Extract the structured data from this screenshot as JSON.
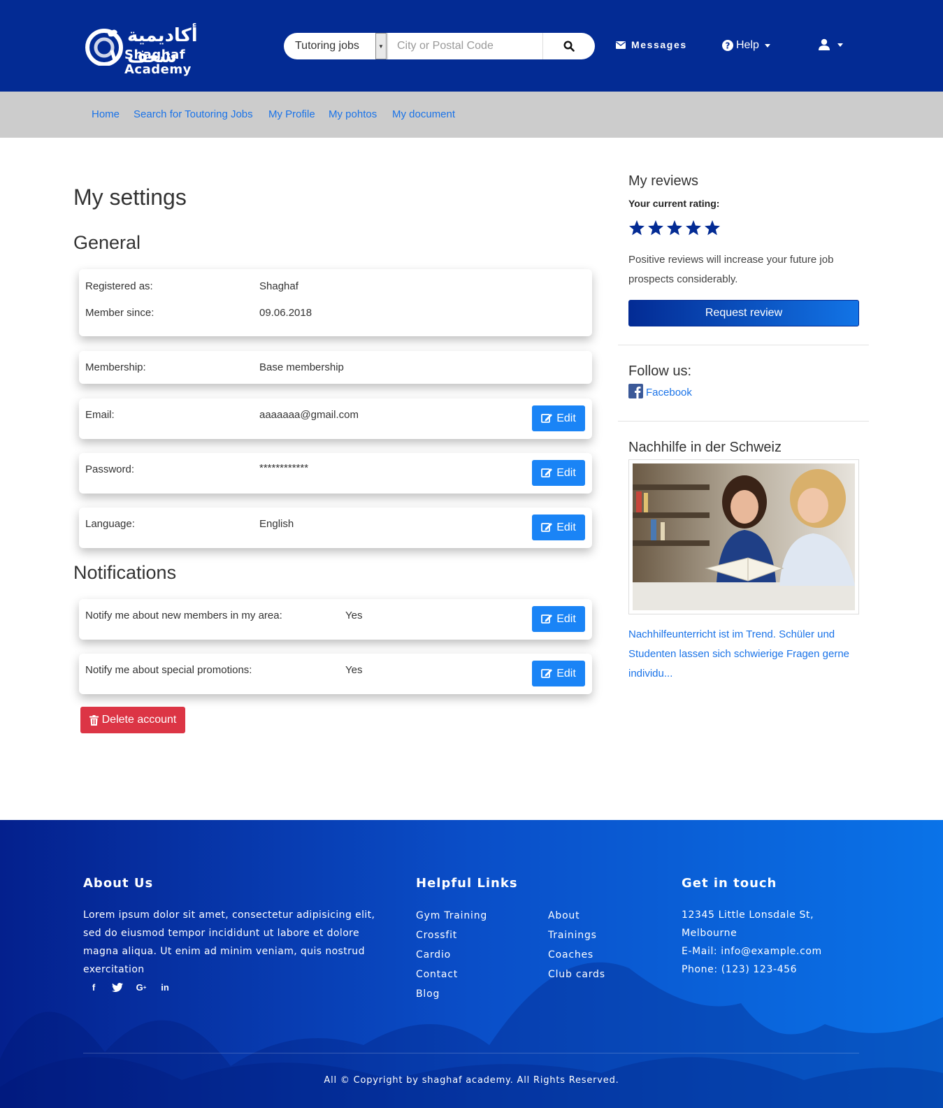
{
  "header": {
    "logo_arabic": "أكاديمية شغف",
    "logo_english": "Shaghaf Academy",
    "search_select_value": "Tutoring jobs",
    "search_placeholder": "City or Postal Code",
    "messages_label": "Messages",
    "help_label": "Help",
    "icons": {
      "search": "search-icon",
      "messages": "envelope-icon",
      "help": "question-circle-icon",
      "user": "user-icon"
    }
  },
  "subnav": {
    "items": [
      {
        "label": "Home"
      },
      {
        "label": "Search for Toutoring Jobs"
      },
      {
        "label": "My Profile"
      },
      {
        "label": "My pohtos"
      },
      {
        "label": "My document"
      }
    ]
  },
  "main": {
    "title": "My settings",
    "general_heading": "General",
    "registered_label": "Registered as:",
    "registered_value": "Shaghaf",
    "member_since_label": "Member since:",
    "member_since_value": "09.06.2018",
    "membership_label": "Membership:",
    "membership_value": "Base membership",
    "email_label": "Email:",
    "email_value": "aaaaaaa@gmail.com",
    "password_label": "Password:",
    "password_value": "************",
    "language_label": "Language:",
    "language_value": "English",
    "edit_label": "Edit",
    "notifications_heading": "Notifications",
    "notify_members_label": "Notify me about new members in my area:",
    "notify_members_value": "Yes",
    "notify_promotions_label": "Notify me about special promotions:",
    "notify_promotions_value": "Yes",
    "delete_label": "Delete account"
  },
  "sidebar": {
    "reviews_heading": "My reviews",
    "rating_label": "Your current rating:",
    "rating_stars": 5,
    "rating_max": 5,
    "reviews_text": "Positive reviews will increase your future job prospects considerably.",
    "request_review_label": "Request review",
    "follow_heading": "Follow us:",
    "facebook_label": "Facebook",
    "blog_heading": "Nachhilfe in der Schweiz",
    "blog_excerpt": "Nachhilfeunterricht ist im Trend. Schüler und Studenten lassen sich schwierige Fragen gerne individu..."
  },
  "footer": {
    "about_heading": "About Us",
    "about_text": "Lorem ipsum dolor sit amet, consectetur adipisicing elit, sed do eiusmod tempor incididunt ut labore et dolore magna aliqua. Ut enim ad minim veniam, quis nostrud exercitation",
    "links_heading": "Helpful Links",
    "links_col1": [
      "Gym Training",
      "Crossfit",
      "Cardio",
      "Contact",
      "Blog"
    ],
    "links_col2": [
      "About",
      "Trainings",
      "Coaches",
      "Club cards"
    ],
    "contact_heading": "Get in touch",
    "contact_lines": [
      "12345 Little Lonsdale St,",
      "Melbourne",
      "E-Mail: info@example.com",
      "Phone: (123) 123-456"
    ],
    "social_icons": [
      "facebook-icon",
      "twitter-icon",
      "google-plus-icon",
      "linkedin-icon"
    ],
    "copyright": "All © Copyright by shaghaf academy. All Rights Reserved."
  },
  "colors": {
    "header_bg": "#032b94",
    "subnav_bg": "#cccccc",
    "link": "#1a73e8",
    "edit_button": "#1a84f6",
    "delete_button": "#dc3545",
    "star": "#032b94"
  }
}
